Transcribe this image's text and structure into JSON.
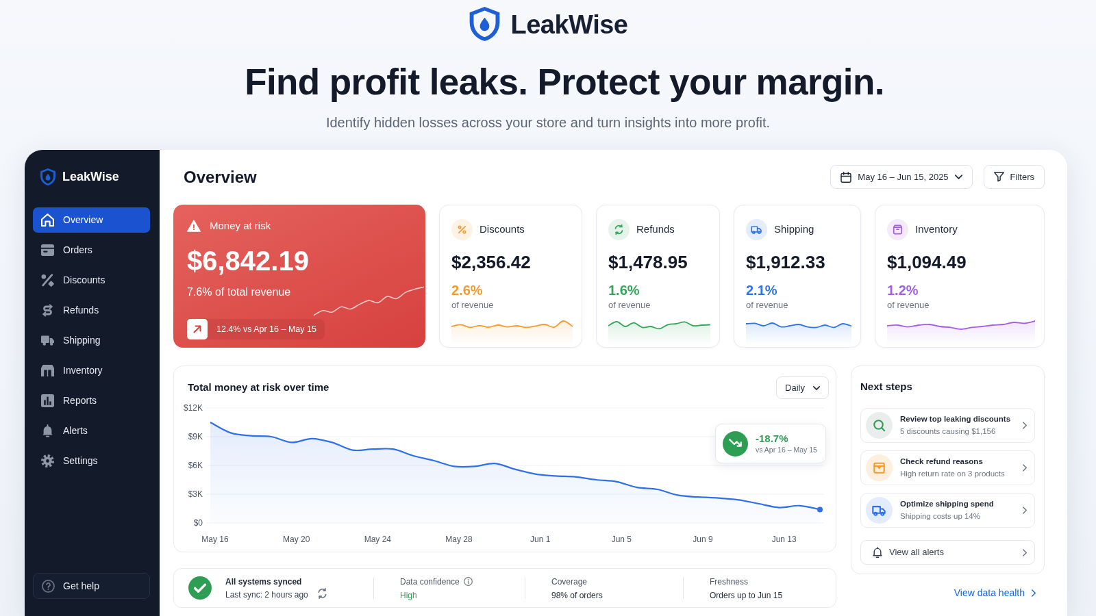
{
  "page_header": {
    "brand": "LeakWise",
    "headline": "Find profit leaks. Protect your margin.",
    "subtitle": "Identify hidden losses across your store and turn insights into more profit."
  },
  "sidebar": {
    "brand": "LeakWise",
    "items": [
      {
        "label": "Overview",
        "selected": true
      },
      {
        "label": "Orders",
        "selected": false
      },
      {
        "label": "Discounts",
        "selected": false
      },
      {
        "label": "Refunds",
        "selected": false
      },
      {
        "label": "Shipping",
        "selected": false
      },
      {
        "label": "Inventory",
        "selected": false
      },
      {
        "label": "Reports",
        "selected": false
      },
      {
        "label": "Alerts",
        "selected": false
      },
      {
        "label": "Settings",
        "selected": false
      }
    ],
    "help": "Get help"
  },
  "toolbar": {
    "title": "Overview",
    "date_range": "May 16 – Jun 15, 2025",
    "filters": "Filters"
  },
  "money_at_risk": {
    "title": "Money at risk",
    "value": "$6,842.19",
    "share": "7.6% of total revenue",
    "trend": "12.4% vs Apr 16 – May 15"
  },
  "metric_cards": [
    {
      "label": "Discounts",
      "value": "$2,356.42",
      "percent": "2.6%",
      "caption": "of revenue",
      "color": "#f59a2c"
    },
    {
      "label": "Refunds",
      "value": "$1,478.95",
      "percent": "1.6%",
      "caption": "of revenue",
      "color": "#36a55a"
    },
    {
      "label": "Shipping",
      "value": "$1,912.33",
      "percent": "2.1%",
      "caption": "of revenue",
      "color": "#2f74e6"
    },
    {
      "label": "Inventory",
      "value": "$1,094.49",
      "percent": "1.2%",
      "caption": "of revenue",
      "color": "#a45ee6"
    }
  ],
  "chart_card": {
    "interval": "Daily",
    "change": {
      "value": "-18.7%",
      "period": "vs Apr 16 – May 15"
    },
    "chart_data": {
      "type": "area",
      "title": "Total money at risk over time",
      "categories": [
        "May 16",
        null,
        null,
        null,
        "May 20",
        null,
        null,
        null,
        "May 24",
        null,
        null,
        null,
        "May 28",
        null,
        null,
        null,
        "Jun 1",
        null,
        null,
        null,
        "Jun 5",
        null,
        null,
        null,
        "Jun 9",
        null,
        null,
        null,
        "Jun 13",
        null,
        null
      ],
      "series": [
        {
          "color": "#2f6fe8",
          "values": [
            10500,
            9400,
            9100,
            9000,
            8400,
            8800,
            8400,
            7600,
            7700,
            7700,
            7000,
            6500,
            5900,
            5900,
            6200,
            5600,
            5100,
            4900,
            4800,
            4500,
            4300,
            3700,
            3500,
            2900,
            2700,
            2600,
            2400,
            2000,
            1600,
            1800,
            1400
          ]
        }
      ],
      "ylim": [
        0,
        12000
      ],
      "yticks": [
        {
          "value": 0,
          "label": "$0"
        },
        {
          "value": 3000,
          "label": "$3K"
        },
        {
          "value": 6000,
          "label": "$6K"
        },
        {
          "value": 9000,
          "label": "$9K"
        },
        {
          "value": 12000,
          "label": "$12K"
        }
      ],
      "grid": true
    }
  },
  "next_steps": {
    "title": "Next steps",
    "items": [
      {
        "title": "Review top leaking discounts",
        "subtitle": "5 discounts causing $1,156"
      },
      {
        "title": "Check refund reasons",
        "subtitle": "High return rate on 3 products"
      },
      {
        "title": "Optimize shipping spend",
        "subtitle": "Shipping costs up 14%"
      }
    ],
    "view_all": "View all alerts",
    "link": "View data health"
  },
  "status_bar": {
    "sync": {
      "title": "All systems synced",
      "detail": "Last sync: 2 hours ago"
    },
    "fields": [
      {
        "label": "Data confidence",
        "value": "High",
        "info": true,
        "color": "#2f9e55"
      },
      {
        "label": "Coverage",
        "value": "98% of orders",
        "info": false,
        "color": "#1f2937"
      },
      {
        "label": "Freshness",
        "value": "Orders up to Jun 15",
        "info": false,
        "color": "#1f2937"
      }
    ]
  }
}
